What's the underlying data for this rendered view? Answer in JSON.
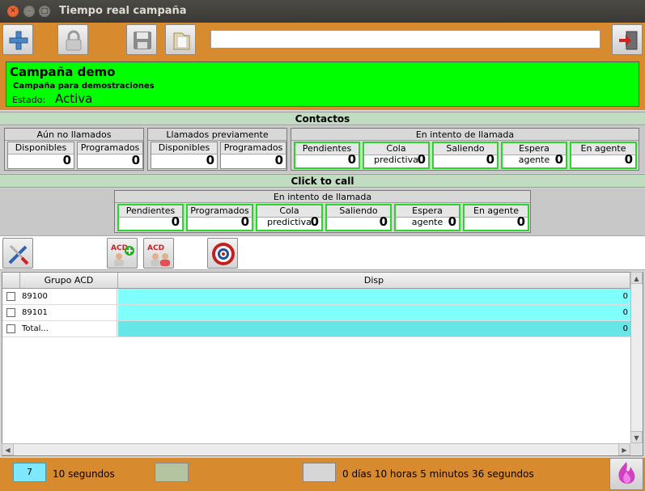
{
  "window": {
    "title": "Tiempo real campaña"
  },
  "toolbar": {
    "search_value": ""
  },
  "campaign": {
    "name": "Campaña demo",
    "description": "Campaña para demostraciones",
    "estado_label": "Estado:",
    "estado_value": "Activa"
  },
  "contactos": {
    "title": "Contactos",
    "aun_no_llamados": {
      "title": "Aún no llamados",
      "cells": [
        {
          "label": "Disponibles",
          "value": "0"
        },
        {
          "label": "Programados",
          "value": "0"
        }
      ]
    },
    "llamados_previamente": {
      "title": "Llamados previamente",
      "cells": [
        {
          "label": "Disponibles",
          "value": "0"
        },
        {
          "label": "Programados",
          "value": "0"
        }
      ]
    },
    "en_intento": {
      "title": "En intento de llamada",
      "cells": [
        {
          "label": "Pendientes",
          "value": "0"
        },
        {
          "label": "Cola predictiva",
          "value": "0"
        },
        {
          "label": "Saliendo",
          "value": "0"
        },
        {
          "label": "Espera agente",
          "value": "0"
        },
        {
          "label": "En agente",
          "value": "0"
        }
      ]
    }
  },
  "click_to_call": {
    "title": "Click to call",
    "en_intento": {
      "title": "En intento de llamada",
      "cells": [
        {
          "label": "Pendientes",
          "value": "0"
        },
        {
          "label": "Programados",
          "value": "0"
        },
        {
          "label": "Cola predictiva",
          "value": "0"
        },
        {
          "label": "Saliendo",
          "value": "0"
        },
        {
          "label": "Espera agente",
          "value": "0"
        },
        {
          "label": "En agente",
          "value": "0"
        }
      ]
    }
  },
  "agent_toolbar": {
    "acd_label": "ACD"
  },
  "table": {
    "columns": [
      "Grupo ACD",
      "Disp"
    ],
    "rows": [
      {
        "name": "89100",
        "disp": "0"
      },
      {
        "name": "89101",
        "disp": "0"
      },
      {
        "name": "Total...",
        "disp": "0"
      }
    ]
  },
  "statusbar": {
    "refresh_value": "7",
    "refresh_label": "10 segundos",
    "elapsed": "0 días 10 horas 5 minutos 36 segundos"
  },
  "colors": {
    "toolbar_bg": "#d88a2e",
    "campaign_active": "#00ff00",
    "section_header": "#c2dcc2",
    "cell_border_active": "#2bd52b",
    "disp_cell": "#80ffff",
    "disp_total": "#66e6e6"
  }
}
